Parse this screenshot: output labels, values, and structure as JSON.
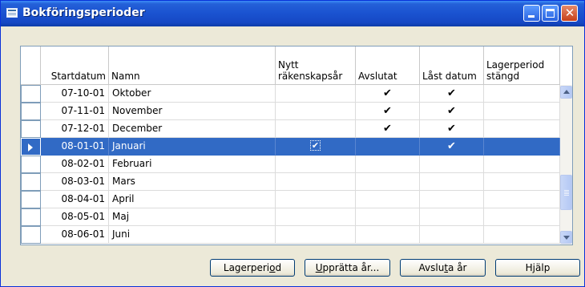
{
  "window": {
    "title": "Bokföringsperioder"
  },
  "columns": {
    "startdatum": "Startdatum",
    "namn": "Namn",
    "nytt": "Nytt\nräkenskapsår",
    "avslutat": "Avslutat",
    "last_datum": "Låst datum",
    "lagerperiod": "Lagerperiod\nstängd"
  },
  "rows": [
    {
      "startdatum": "07-10-01",
      "namn": "Oktober",
      "nytt": false,
      "avslutat": true,
      "last_datum": true,
      "lagerperiod": false,
      "selected": false
    },
    {
      "startdatum": "07-11-01",
      "namn": "November",
      "nytt": false,
      "avslutat": true,
      "last_datum": true,
      "lagerperiod": false,
      "selected": false
    },
    {
      "startdatum": "07-12-01",
      "namn": "December",
      "nytt": false,
      "avslutat": true,
      "last_datum": true,
      "lagerperiod": false,
      "selected": false
    },
    {
      "startdatum": "08-01-01",
      "namn": "Januari",
      "nytt": true,
      "avslutat": false,
      "last_datum": true,
      "lagerperiod": false,
      "selected": true
    },
    {
      "startdatum": "08-02-01",
      "namn": "Februari",
      "nytt": false,
      "avslutat": false,
      "last_datum": false,
      "lagerperiod": false,
      "selected": false
    },
    {
      "startdatum": "08-03-01",
      "namn": "Mars",
      "nytt": false,
      "avslutat": false,
      "last_datum": false,
      "lagerperiod": false,
      "selected": false
    },
    {
      "startdatum": "08-04-01",
      "namn": "April",
      "nytt": false,
      "avslutat": false,
      "last_datum": false,
      "lagerperiod": false,
      "selected": false
    },
    {
      "startdatum": "08-05-01",
      "namn": "Maj",
      "nytt": false,
      "avslutat": false,
      "last_datum": false,
      "lagerperiod": false,
      "selected": false
    },
    {
      "startdatum": "08-06-01",
      "namn": "Juni",
      "nytt": false,
      "avslutat": false,
      "last_datum": false,
      "lagerperiod": false,
      "selected": false
    }
  ],
  "buttons": {
    "lagerperiod": {
      "before": "Lagerperi",
      "accel": "o",
      "after": "d"
    },
    "uppratta": {
      "before": "",
      "accel": "U",
      "after": "pprätta år..."
    },
    "avsluta": {
      "before": "Avslu",
      "accel": "t",
      "after": "a år"
    },
    "hjalp": {
      "before": "",
      "accel": "",
      "after": "Hjälp"
    }
  },
  "glyphs": {
    "check": "✔",
    "close": "✕"
  }
}
